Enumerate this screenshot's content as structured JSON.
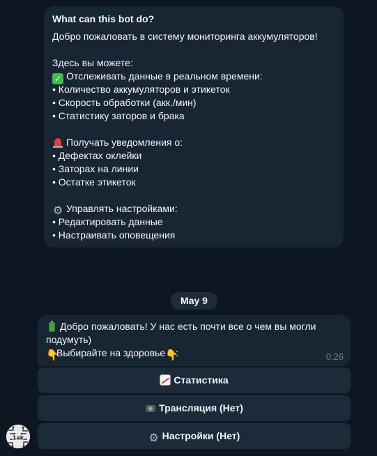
{
  "intro": {
    "title": "What can this bot do?",
    "welcome": "Добро пожаловать в систему мониторинга аккумуляторов!",
    "here_you_can": "Здесь вы можете:",
    "track_header": "Отслеживать данные в реальном времени:",
    "track_items": [
      "• Количество аккумуляторов и этикеток",
      "• Скорость обработки (акк./мин)",
      "• Статистику заторов и брака"
    ],
    "notify_header": "Получать уведомления о:",
    "notify_items": [
      "• Дефектах оклейки",
      "• Заторах на линии",
      "• Остатке этикеток"
    ],
    "manage_header": "Управлять настройками:",
    "manage_items": [
      "• Редактировать данные",
      "• Настраивать оповещения"
    ]
  },
  "date_separator": "May 9",
  "message": {
    "line1": "Добро пожаловать! У нас есть почти все о чем вы могли",
    "line2": "подумуть)",
    "line3": "Выбирайте на здоровье",
    "line3_suffix": ":",
    "time": "0:26"
  },
  "keyboard": {
    "stats_label": "Статистика",
    "stream_label": "Трансляция (Нет)",
    "settings_label": "Настройки (Нет)"
  },
  "avatar": {
    "text": "1ak"
  },
  "icons": {
    "check": "check-mark-emoji",
    "siren": "siren-emoji",
    "gear": "gear-emoji",
    "battery": "battery-emoji",
    "hand": "pointing-down-hand-emoji",
    "chart": "chart-increasing-emoji",
    "camera": "film-camera-emoji"
  },
  "colors": {
    "background": "#0e1621",
    "bubble": "#182533",
    "button": "#1c2b3a",
    "timestamp": "#6d7f8f"
  }
}
